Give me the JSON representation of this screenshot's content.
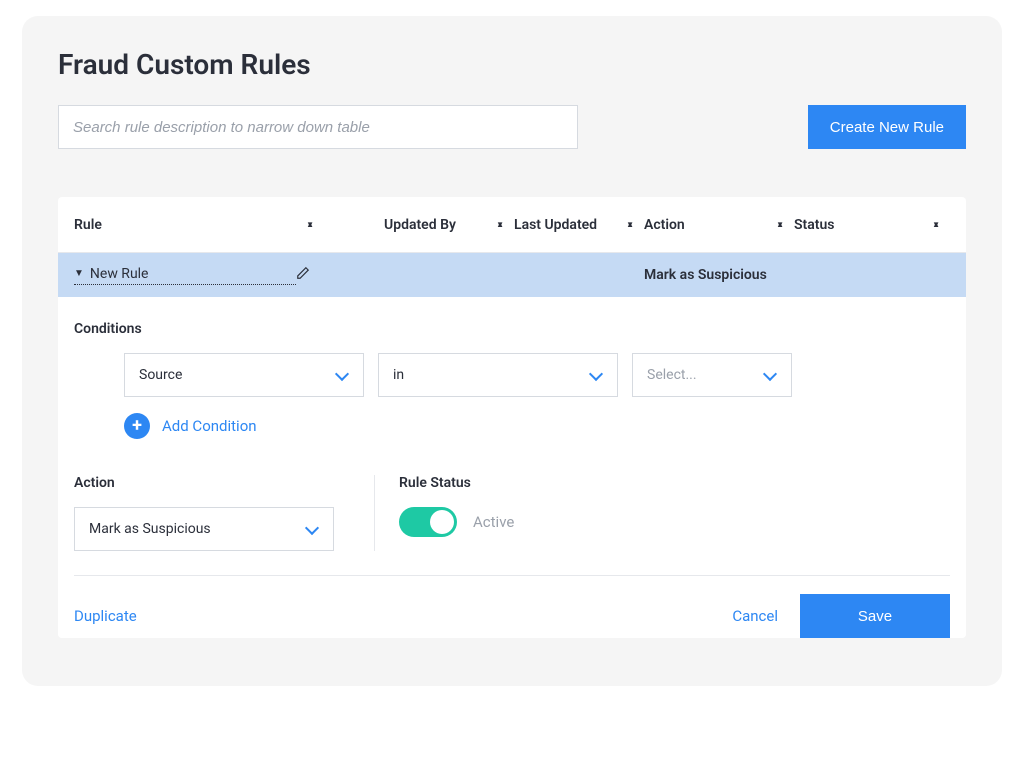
{
  "page": {
    "title": "Fraud Custom Rules",
    "search_placeholder": "Search rule description to narrow down table",
    "create_button": "Create New Rule"
  },
  "table": {
    "columns": {
      "rule": "Rule",
      "updated_by": "Updated By",
      "last_updated": "Last Updated",
      "action": "Action",
      "status": "Status"
    },
    "row": {
      "name": "New Rule",
      "updated_by": "",
      "last_updated": "",
      "action": "Mark as Suspicious",
      "status": ""
    }
  },
  "editor": {
    "conditions_label": "Conditions",
    "condition": {
      "field": "Source",
      "operator": "in",
      "value_placeholder": "Select..."
    },
    "add_condition_label": "Add Condition",
    "action_label": "Action",
    "action_value": "Mark as Suspicious",
    "rule_status_label": "Rule Status",
    "rule_status_value": "Active"
  },
  "footer": {
    "duplicate": "Duplicate",
    "cancel": "Cancel",
    "save": "Save"
  }
}
